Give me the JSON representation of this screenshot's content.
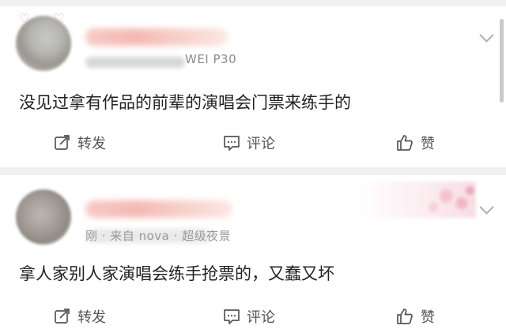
{
  "colors": {
    "background": "#ffffff",
    "separator": "#f1f1f1",
    "text": "#222222",
    "meta": "#8a8a8a",
    "action": "#555555"
  },
  "posts": [
    {
      "meta_suffix": "WEI P30",
      "content": "没见过拿有作品的前辈的演唱会门票来练手的",
      "actions": {
        "repost": "转发",
        "comment": "评论",
        "like": "赞"
      }
    },
    {
      "meta_visible": "刚 · 来自 nova ·  超级夜景",
      "content": "拿人家别人家演唱会练手抢票的，又蠢又坏",
      "actions": {
        "repost": "转发",
        "comment": "评论",
        "like": "赞"
      }
    }
  ],
  "icons": {
    "repost": "repost-icon",
    "comment": "comment-icon",
    "like": "thumbs-up-icon",
    "menu": "chevron-down-icon"
  }
}
